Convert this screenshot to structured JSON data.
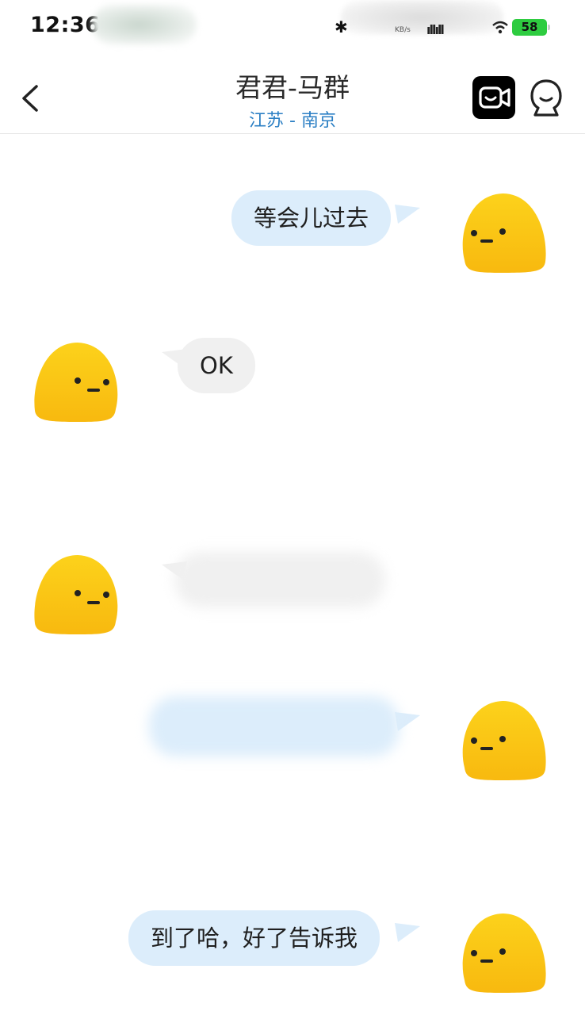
{
  "status_bar": {
    "time": "12:36",
    "network_unit": "KB/s",
    "battery": "58"
  },
  "header": {
    "title": "君君-马群",
    "subtitle": "江苏 - 南京"
  },
  "messages": [
    {
      "direction": "out",
      "text": "等会儿过去"
    },
    {
      "direction": "in",
      "text": "OK"
    },
    {
      "direction": "in",
      "text": ""
    },
    {
      "direction": "out",
      "text": ""
    },
    {
      "direction": "out",
      "text": "到了哈，好了告诉我"
    }
  ],
  "colors": {
    "outgoing_bubble": "#dcedfb",
    "incoming_bubble": "#f0f0f0",
    "location_text": "#2b7fc4",
    "avatar_yellow": "#fcc419"
  }
}
